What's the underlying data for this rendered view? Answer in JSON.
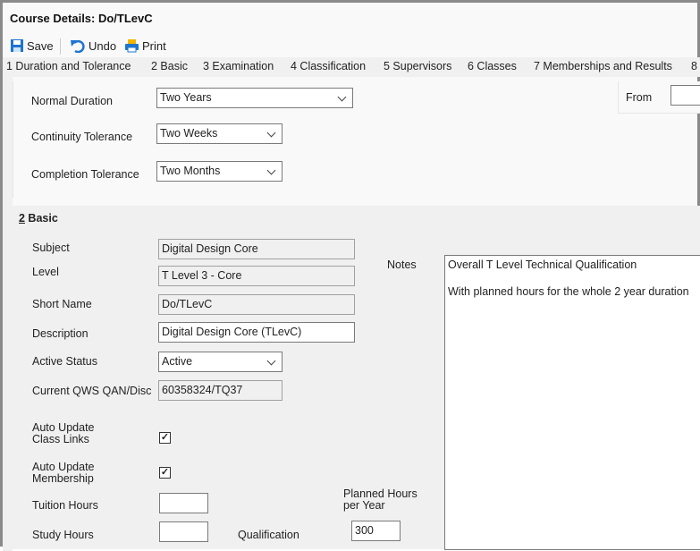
{
  "window": {
    "title": "Course Details: Do/TLevC"
  },
  "toolbar": {
    "save": "Save",
    "undo": "Undo",
    "print": "Print"
  },
  "tabs": [
    "1 Duration and Tolerance",
    "2 Basic",
    "3 Examination",
    "4 Classification",
    "5 Supervisors",
    "6 Classes",
    "7 Memberships and Results",
    "8"
  ],
  "duration": {
    "normal_duration_label": "Normal Duration",
    "normal_duration": "Two Years",
    "continuity_label": "Continuity Tolerance",
    "continuity": "Two Weeks",
    "completion_label": "Completion Tolerance",
    "completion": "Two Months",
    "from_label": "From",
    "from_value": ""
  },
  "basic": {
    "heading_num": "2",
    "heading_text": " Basic",
    "subject_label": "Subject",
    "subject": "Digital Design Core",
    "level_label": "Level",
    "level": "T Level 3 - Core",
    "short_name_label": "Short Name",
    "short_name": "Do/TLevC",
    "description_label": "Description",
    "description": "Digital Design Core (TLevC)",
    "active_status_label": "Active Status",
    "active_status": "Active",
    "qws_label": "Current QWS QAN/Disc",
    "qws": "60358324/TQ37",
    "auto_class_label_1": "Auto Update",
    "auto_class_label_2": "Class Links",
    "auto_class_checked": true,
    "auto_member_label_1": "Auto Update",
    "auto_member_label_2": "Membership",
    "auto_member_checked": true,
    "tuition_label": "Tuition Hours",
    "tuition": "",
    "study_label": "Study Hours",
    "study": "",
    "qualification_label": "Qualification",
    "planned_label_1": "Planned Hours",
    "planned_label_2": "per Year",
    "planned": "300",
    "notes_label": "Notes",
    "notes_line1": "Overall T Level Technical Qualification",
    "notes_line2": "With planned hours  for the whole 2 year duration"
  }
}
